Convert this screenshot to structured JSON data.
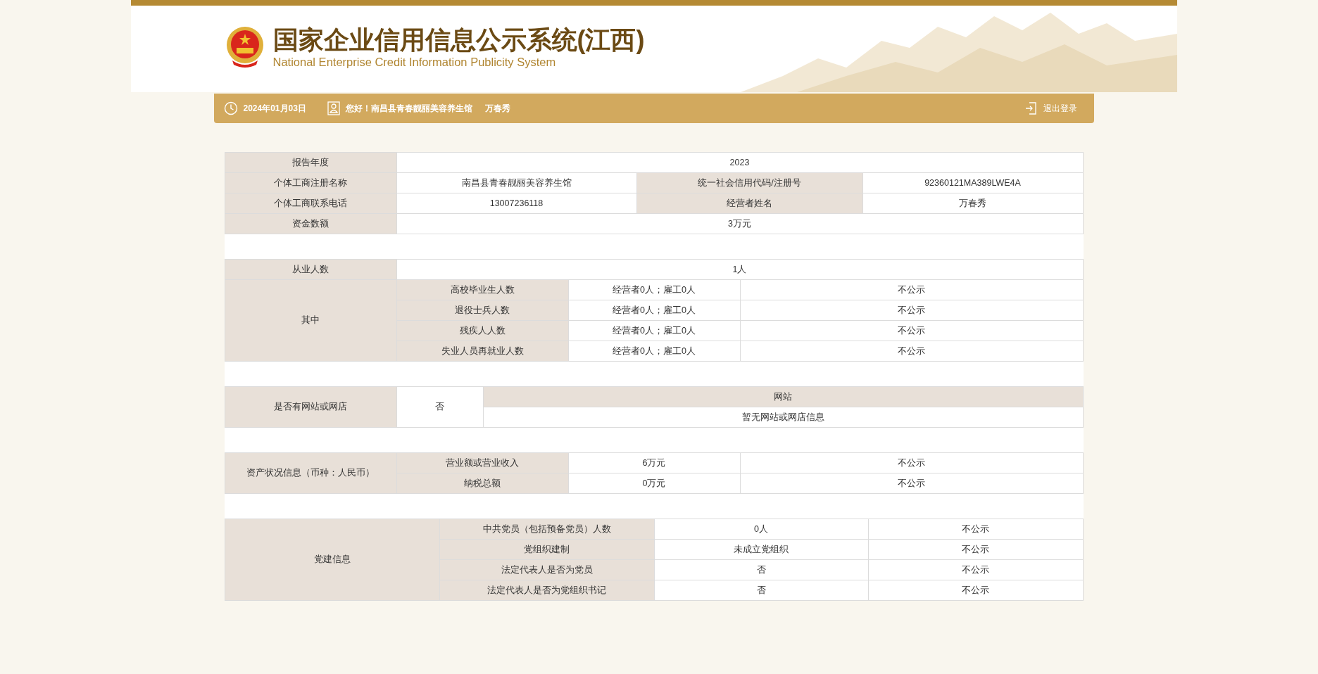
{
  "header": {
    "title": "国家企业信用信息公示系统(江西)",
    "subtitle": "National Enterprise Credit Information Publicity System"
  },
  "info_bar": {
    "date": "2024年01月03日",
    "greeting": "您好！南昌县青春靓丽美容养生馆",
    "user": "万春秀",
    "logout": "退出登录"
  },
  "sections": [
    {
      "rows": [
        [
          {
            "kind": "label",
            "text": "报告年度"
          },
          {
            "kind": "value",
            "text": "2023",
            "colspan": 3
          }
        ],
        [
          {
            "kind": "label",
            "text": "个体工商注册名称"
          },
          {
            "kind": "value",
            "text": "南昌县青春靓丽美容养生馆"
          },
          {
            "kind": "label",
            "text": "统一社会信用代码/注册号"
          },
          {
            "kind": "value",
            "text": "92360121MA389LWE4A"
          }
        ],
        [
          {
            "kind": "label",
            "text": "个体工商联系电话"
          },
          {
            "kind": "value",
            "text": "13007236118"
          },
          {
            "kind": "label",
            "text": "经营者姓名"
          },
          {
            "kind": "value",
            "text": "万春秀"
          }
        ],
        [
          {
            "kind": "label",
            "text": "资金数额"
          },
          {
            "kind": "value",
            "text": "3万元",
            "colspan": 3
          }
        ]
      ]
    },
    {
      "rows": [
        [
          {
            "kind": "label",
            "text": "从业人数"
          },
          {
            "kind": "value",
            "text": "1人",
            "colspan": 3
          }
        ],
        [
          {
            "kind": "label",
            "text": "其中",
            "rowspan": 4
          },
          {
            "kind": "label",
            "text": "高校毕业生人数"
          },
          {
            "kind": "value",
            "text": "经营者0人；雇工0人"
          },
          {
            "kind": "value",
            "text": "不公示"
          }
        ],
        [
          {
            "kind": "label",
            "text": "退役士兵人数"
          },
          {
            "kind": "value",
            "text": "经营者0人；雇工0人"
          },
          {
            "kind": "value",
            "text": "不公示"
          }
        ],
        [
          {
            "kind": "label",
            "text": "残疾人人数"
          },
          {
            "kind": "value",
            "text": "经营者0人；雇工0人"
          },
          {
            "kind": "value",
            "text": "不公示"
          }
        ],
        [
          {
            "kind": "label",
            "text": "失业人员再就业人数"
          },
          {
            "kind": "value",
            "text": "经营者0人；雇工0人"
          },
          {
            "kind": "value",
            "text": "不公示"
          }
        ]
      ]
    },
    {
      "rows": [
        [
          {
            "kind": "label",
            "text": "是否有网站或网店",
            "rowspan": 2
          },
          {
            "kind": "value",
            "text": "否",
            "rowspan": 2
          },
          {
            "kind": "label",
            "text": "网站"
          }
        ],
        [
          {
            "kind": "value",
            "text": "暂无网站或网店信息"
          }
        ]
      ]
    },
    {
      "rows": [
        [
          {
            "kind": "label",
            "text": "资产状况信息（币种：人民币）",
            "rowspan": 2
          },
          {
            "kind": "label",
            "text": "营业额或营业收入"
          },
          {
            "kind": "value",
            "text": "6万元"
          },
          {
            "kind": "value",
            "text": "不公示"
          }
        ],
        [
          {
            "kind": "label",
            "text": "纳税总额"
          },
          {
            "kind": "value",
            "text": "0万元"
          },
          {
            "kind": "value",
            "text": "不公示"
          }
        ]
      ]
    },
    {
      "rows": [
        [
          {
            "kind": "label",
            "text": "党建信息",
            "rowspan": 4
          },
          {
            "kind": "label",
            "text": "中共党员（包括预备党员）人数"
          },
          {
            "kind": "value",
            "text": "0人"
          },
          {
            "kind": "value",
            "text": "不公示"
          }
        ],
        [
          {
            "kind": "label",
            "text": "党组织建制"
          },
          {
            "kind": "value",
            "text": "未成立党组织"
          },
          {
            "kind": "value",
            "text": "不公示"
          }
        ],
        [
          {
            "kind": "label",
            "text": "法定代表人是否为党员"
          },
          {
            "kind": "value",
            "text": "否"
          },
          {
            "kind": "value",
            "text": "不公示"
          }
        ],
        [
          {
            "kind": "label",
            "text": "法定代表人是否为党组织书记"
          },
          {
            "kind": "value",
            "text": "否"
          },
          {
            "kind": "value",
            "text": "不公示"
          }
        ]
      ]
    }
  ]
}
